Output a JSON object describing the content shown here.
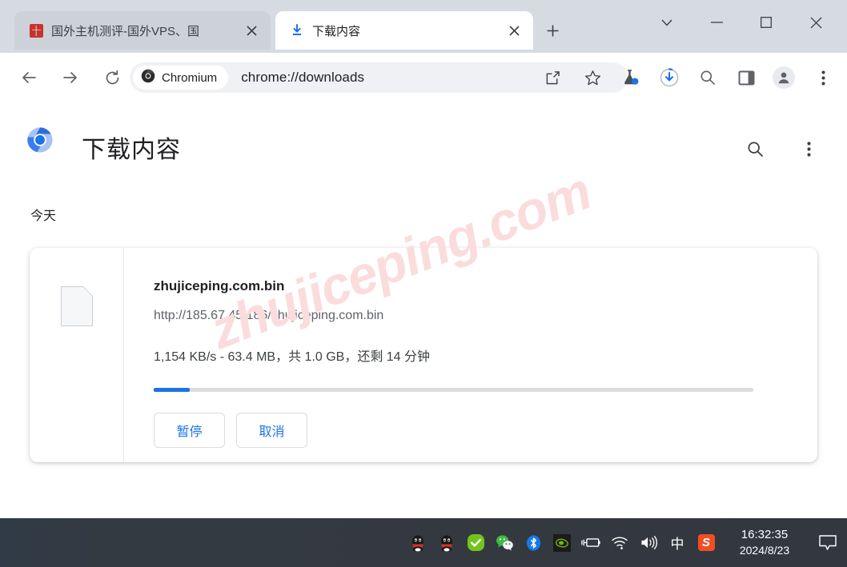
{
  "window": {
    "controls": [
      {
        "name": "tab-search",
        "glyph": "chevron-down"
      },
      {
        "name": "minimize",
        "glyph": "minimize"
      },
      {
        "name": "maximize",
        "glyph": "maximize"
      },
      {
        "name": "close",
        "glyph": "close"
      }
    ]
  },
  "tabs": [
    {
      "title": "国外主机测评-国外VPS、国",
      "favicon": "site-favicon-red",
      "active": false
    },
    {
      "title": "下载内容",
      "favicon": "download-icon",
      "active": true
    }
  ],
  "newtab_label": "+",
  "toolbar": {
    "back_icon": "back-arrow-icon",
    "forward_icon": "forward-arrow-icon",
    "reload_icon": "reload-icon",
    "chip_label": "Chromium",
    "chip_icon": "chromium-logo-icon",
    "url": "chrome://downloads",
    "share_icon": "share-icon",
    "bookmark_icon": "star-icon",
    "experiments_icon": "flask-icon",
    "downloads_icon": "download-progress-icon",
    "search_icon": "search-icon",
    "side_panel_icon": "side-panel-icon",
    "profile_icon": "profile-avatar-icon",
    "menu_icon": "three-dot-menu-icon"
  },
  "page": {
    "logo": "chromium-logo-icon",
    "title": "下载内容",
    "search_icon": "search-icon",
    "menu_icon": "three-dot-menu-icon",
    "date_group": "今天",
    "watermark": "zhujiceping.com"
  },
  "download": {
    "file_icon": "generic-file-icon",
    "filename": "zhujiceping.com.bin",
    "url": "http://185.67.45.186/zhujiceping.com.bin",
    "status": "1,154 KB/s - 63.4 MB，共 1.0 GB，还剩 14 分钟",
    "speed": "1,154 KB/s",
    "downloaded": "63.4 MB",
    "total_size": "1.0 GB",
    "time_remaining": "14 分钟",
    "progress_percent": 6,
    "progress_color": "#1a73e8",
    "track_color": "#dadce0",
    "buttons": [
      {
        "label": "暂停",
        "name": "pause-button",
        "color": "#1a73e8"
      },
      {
        "label": "取消",
        "name": "cancel-button",
        "color": "#1a73e8"
      }
    ]
  },
  "taskbar": {
    "tray_icons": [
      {
        "name": "qq-icon"
      },
      {
        "name": "qq-icon-2"
      },
      {
        "name": "security-check-icon"
      },
      {
        "name": "wechat-icon"
      },
      {
        "name": "bluetooth-icon"
      },
      {
        "name": "nvidia-icon"
      },
      {
        "name": "battery-icon"
      },
      {
        "name": "wifi-icon"
      },
      {
        "name": "volume-icon"
      },
      {
        "name": "ime-chinese-icon",
        "glyph": "中"
      },
      {
        "name": "sogou-icon",
        "glyph": "S"
      }
    ],
    "time": "16:32:35",
    "date": "2024/8/23",
    "notification_icon": "notification-bubble-icon"
  }
}
